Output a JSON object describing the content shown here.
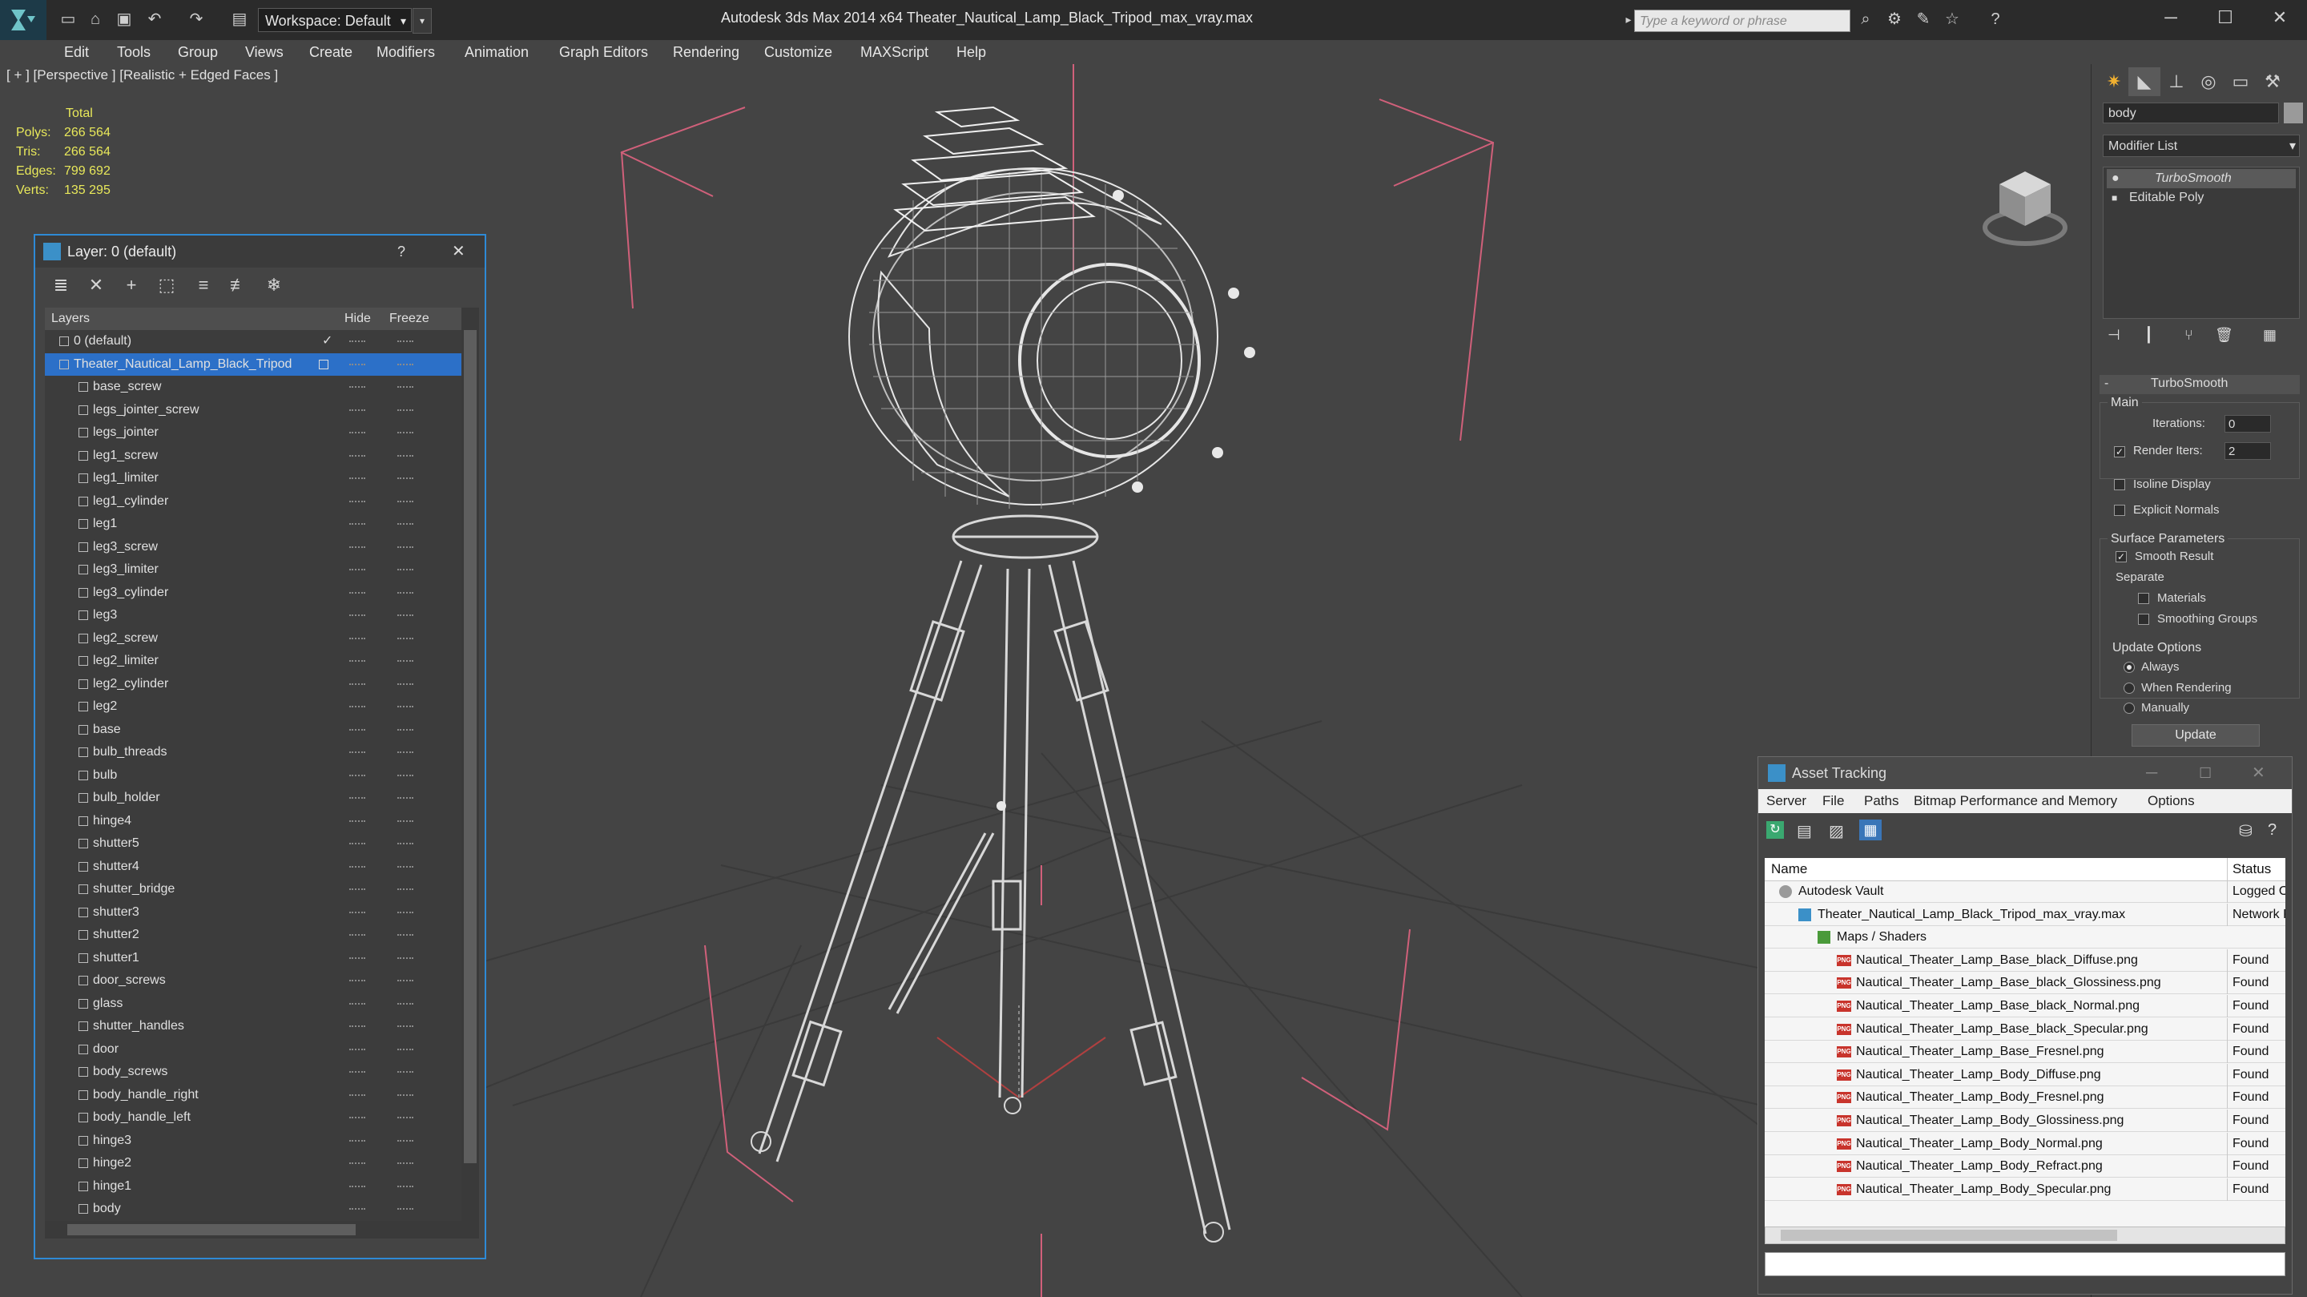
{
  "titlebar": {
    "workspace_label": "Workspace: Default",
    "app_title": "Autodesk 3ds Max  2014 x64     Theater_Nautical_Lamp_Black_Tripod_max_vray.max",
    "search_placeholder": "Type a keyword or phrase",
    "minimize": "─",
    "maximize": "☐",
    "close": "✕"
  },
  "menubar": {
    "items": [
      "Edit",
      "Tools",
      "Group",
      "Views",
      "Create",
      "Modifiers",
      "Animation",
      "Graph Editors",
      "Rendering",
      "Customize",
      "MAXScript",
      "Help"
    ]
  },
  "viewport": {
    "label": "[ + ] [Perspective ] [Realistic + Edged Faces ]",
    "stats_header": "Total",
    "stats": [
      {
        "label": "Polys:",
        "value": "266 564"
      },
      {
        "label": "Tris:",
        "value": "266 564"
      },
      {
        "label": "Edges:",
        "value": "799 692"
      },
      {
        "label": "Verts:",
        "value": "135 295"
      }
    ]
  },
  "layer_panel": {
    "title": "Layer: 0 (default)",
    "help": "?",
    "close": "✕",
    "col_layers": "Layers",
    "col_hide": "Hide",
    "col_freeze": "Freeze",
    "rows": [
      {
        "name": "0 (default)",
        "level": 0
      },
      {
        "name": "Theater_Nautical_Lamp_Black_Tripod",
        "level": 0
      },
      {
        "name": "base_screw",
        "level": 1
      },
      {
        "name": "legs_jointer_screw",
        "level": 1
      },
      {
        "name": "legs_jointer",
        "level": 1
      },
      {
        "name": "leg1_screw",
        "level": 1
      },
      {
        "name": "leg1_limiter",
        "level": 1
      },
      {
        "name": "leg1_cylinder",
        "level": 1
      },
      {
        "name": "leg1",
        "level": 1
      },
      {
        "name": "leg3_screw",
        "level": 1
      },
      {
        "name": "leg3_limiter",
        "level": 1
      },
      {
        "name": "leg3_cylinder",
        "level": 1
      },
      {
        "name": "leg3",
        "level": 1
      },
      {
        "name": "leg2_screw",
        "level": 1
      },
      {
        "name": "leg2_limiter",
        "level": 1
      },
      {
        "name": "leg2_cylinder",
        "level": 1
      },
      {
        "name": "leg2",
        "level": 1
      },
      {
        "name": "base",
        "level": 1
      },
      {
        "name": "bulb_threads",
        "level": 1
      },
      {
        "name": "bulb",
        "level": 1
      },
      {
        "name": "bulb_holder",
        "level": 1
      },
      {
        "name": "hinge4",
        "level": 1
      },
      {
        "name": "shutter5",
        "level": 1
      },
      {
        "name": "shutter4",
        "level": 1
      },
      {
        "name": "shutter_bridge",
        "level": 1
      },
      {
        "name": "shutter3",
        "level": 1
      },
      {
        "name": "shutter2",
        "level": 1
      },
      {
        "name": "shutter1",
        "level": 1
      },
      {
        "name": "door_screws",
        "level": 1
      },
      {
        "name": "glass",
        "level": 1
      },
      {
        "name": "shutter_handles",
        "level": 1
      },
      {
        "name": "door",
        "level": 1
      },
      {
        "name": "body_screws",
        "level": 1
      },
      {
        "name": "body_handle_right",
        "level": 1
      },
      {
        "name": "body_handle_left",
        "level": 1
      },
      {
        "name": "hinge3",
        "level": 1
      },
      {
        "name": "hinge2",
        "level": 1
      },
      {
        "name": "hinge1",
        "level": 1
      },
      {
        "name": "body",
        "level": 1
      }
    ]
  },
  "command_panel": {
    "object_name": "body",
    "modifier_list": "Modifier List",
    "stack": [
      "TurboSmooth",
      "Editable Poly"
    ],
    "rollout_title": "TurboSmooth",
    "main_label": "Main",
    "iterations_label": "Iterations:",
    "iterations_value": "0",
    "render_iters_label": "Render Iters:",
    "render_iters_value": "2",
    "isoline_label": "Isoline Display",
    "explicit_normals_label": "Explicit Normals",
    "surface_params_label": "Surface Parameters",
    "smooth_result_label": "Smooth Result",
    "separate_label": "Separate",
    "materials_label": "Materials",
    "smoothing_groups_label": "Smoothing Groups",
    "update_options_label": "Update Options",
    "always_label": "Always",
    "when_rendering_label": "When Rendering",
    "manually_label": "Manually",
    "update_button": "Update"
  },
  "asset_tracking": {
    "title": "Asset Tracking",
    "menu": [
      "Server",
      "File",
      "Paths",
      "Bitmap Performance and Memory",
      "Options"
    ],
    "col_name": "Name",
    "col_status": "Status",
    "rows": [
      {
        "name": "Autodesk Vault",
        "status": "Logged Out",
        "indent": 0,
        "icon": "vault"
      },
      {
        "name": "Theater_Nautical_Lamp_Black_Tripod_max_vray.max",
        "status": "Network Path",
        "indent": 1,
        "icon": "max"
      },
      {
        "name": "Maps / Shaders",
        "status": "",
        "indent": 2,
        "icon": "maps"
      },
      {
        "name": "Nautical_Theater_Lamp_Base_black_Diffuse.png",
        "status": "Found",
        "indent": 3,
        "icon": "png"
      },
      {
        "name": "Nautical_Theater_Lamp_Base_black_Glossiness.png",
        "status": "Found",
        "indent": 3,
        "icon": "png"
      },
      {
        "name": "Nautical_Theater_Lamp_Base_black_Normal.png",
        "status": "Found",
        "indent": 3,
        "icon": "png"
      },
      {
        "name": "Nautical_Theater_Lamp_Base_black_Specular.png",
        "status": "Found",
        "indent": 3,
        "icon": "png"
      },
      {
        "name": "Nautical_Theater_Lamp_Base_Fresnel.png",
        "status": "Found",
        "indent": 3,
        "icon": "png"
      },
      {
        "name": "Nautical_Theater_Lamp_Body_Diffuse.png",
        "status": "Found",
        "indent": 3,
        "icon": "png"
      },
      {
        "name": "Nautical_Theater_Lamp_Body_Fresnel.png",
        "status": "Found",
        "indent": 3,
        "icon": "png"
      },
      {
        "name": "Nautical_Theater_Lamp_Body_Glossiness.png",
        "status": "Found",
        "indent": 3,
        "icon": "png"
      },
      {
        "name": "Nautical_Theater_Lamp_Body_Normal.png",
        "status": "Found",
        "indent": 3,
        "icon": "png"
      },
      {
        "name": "Nautical_Theater_Lamp_Body_Refract.png",
        "status": "Found",
        "indent": 3,
        "icon": "png"
      },
      {
        "name": "Nautical_Theater_Lamp_Body_Specular.png",
        "status": "Found",
        "indent": 3,
        "icon": "png"
      }
    ]
  },
  "colors": {
    "selection_blue": "#2c70c8",
    "stats_yellow": "#e8e85a",
    "bounding_box_pink": "#d0607a"
  }
}
